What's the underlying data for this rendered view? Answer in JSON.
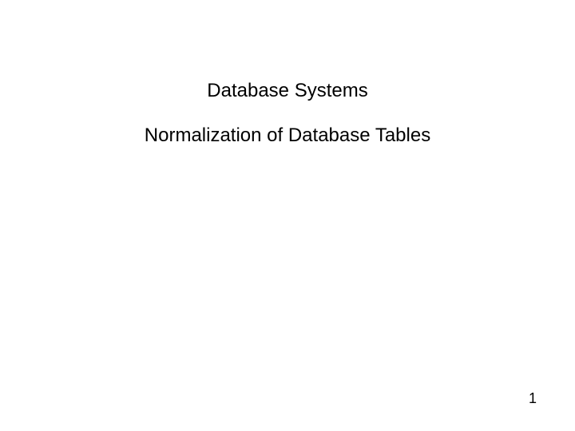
{
  "slide": {
    "title": "Database Systems",
    "subtitle": "Normalization of Database Tables",
    "page_number": "1"
  }
}
